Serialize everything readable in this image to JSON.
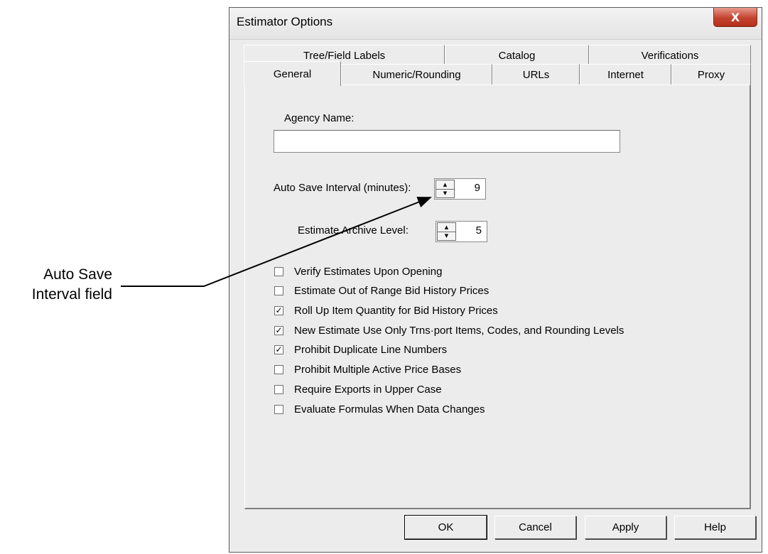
{
  "callout": {
    "line1": "Auto Save",
    "line2": "Interval field"
  },
  "dialog": {
    "title": "Estimator Options",
    "close_glyph": "X",
    "tabs_row1": [
      {
        "label": "Tree/Field Labels"
      },
      {
        "label": "Catalog"
      },
      {
        "label": "Verifications"
      }
    ],
    "tabs_row2": [
      {
        "label": "General",
        "active": true
      },
      {
        "label": "Numeric/Rounding"
      },
      {
        "label": "URLs"
      },
      {
        "label": "Internet"
      },
      {
        "label": "Proxy"
      }
    ],
    "general": {
      "agency_name_label": "Agency Name:",
      "agency_name_value": "",
      "auto_save_label": "Auto Save Interval (minutes):",
      "auto_save_value": "9",
      "archive_label": "Estimate Archive Level:",
      "archive_value": "5",
      "checkboxes": [
        {
          "label": "Verify Estimates Upon Opening",
          "checked": false
        },
        {
          "label": "Estimate Out of Range Bid History Prices",
          "checked": false
        },
        {
          "label": "Roll Up Item Quantity for Bid History Prices",
          "checked": true
        },
        {
          "label": "New Estimate Use Only Trns·port Items, Codes, and Rounding Levels",
          "checked": true
        },
        {
          "label": "Prohibit Duplicate Line Numbers",
          "checked": true
        },
        {
          "label": "Prohibit Multiple Active Price Bases",
          "checked": false
        },
        {
          "label": "Require Exports in Upper Case",
          "checked": false
        },
        {
          "label": "Evaluate Formulas When Data Changes",
          "checked": false
        }
      ]
    },
    "buttons": {
      "ok": "OK",
      "cancel": "Cancel",
      "apply": "Apply",
      "help": "Help"
    }
  }
}
